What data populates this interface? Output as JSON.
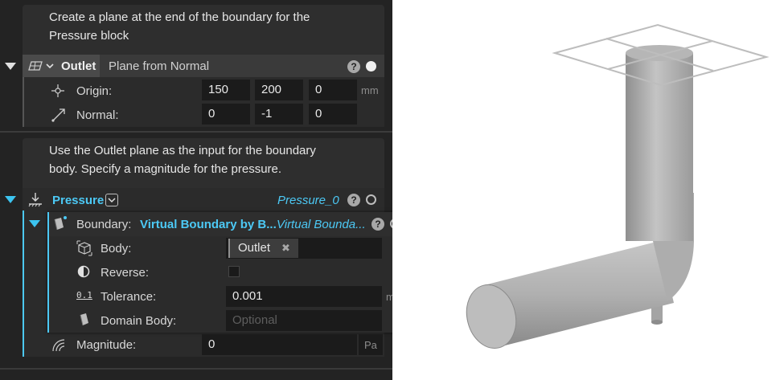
{
  "notes": {
    "outlet_note": [
      "Create a plane at the end of the boundary for the",
      "Pressure block"
    ],
    "pressure_note": [
      "Use the Outlet plane as the input for the boundary",
      "body. Specify a magnitude for the pressure."
    ]
  },
  "outlet_block": {
    "name": "Outlet",
    "type": "Plane from Normal",
    "origin_label": "Origin:",
    "origin": [
      "150",
      "200",
      "0"
    ],
    "origin_unit": "mm",
    "normal_label": "Normal:",
    "normal": [
      "0",
      "-1",
      "0"
    ],
    "help": "?"
  },
  "pressure_block": {
    "name": "Pressure",
    "instance": "Pressure_0",
    "help": "?",
    "boundary": {
      "label": "Boundary:",
      "type": "Virtual Boundary by B...",
      "instance": "Virtual Bounda...",
      "help": "?",
      "body_label": "Body:",
      "body_value": "Outlet",
      "body_remove": "✖",
      "reverse_label": "Reverse:",
      "reverse_checked": false,
      "tolerance_label": "Tolerance:",
      "tolerance_icon": "0.1",
      "tolerance_value": "0.001",
      "tolerance_unit": "mm",
      "domain_body_label": "Domain Body:",
      "domain_body_placeholder": "Optional"
    },
    "magnitude_label": "Magnitude:",
    "magnitude_value": "0",
    "magnitude_unit": "Pa"
  },
  "icons": {
    "outlet": "plane-icon",
    "origin": "origin-point-icon",
    "normal": "normal-vector-icon",
    "pressure": "pressure-load-icon",
    "boundary": "boundary-body-icon",
    "body": "body-selection-icon",
    "reverse": "half-circle-icon",
    "tolerance": "tolerance-icon",
    "domain_body": "domain-body-icon",
    "magnitude": "magnitude-icon"
  },
  "colors": {
    "accent": "#4cc9f5",
    "panel_bg": "#232323",
    "field_bg": "#1b1b1b"
  }
}
